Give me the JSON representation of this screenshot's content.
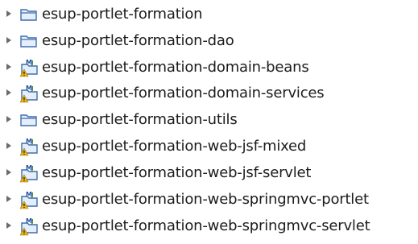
{
  "project_explorer": {
    "items": [
      {
        "label": "esup-portlet-formation",
        "icon": "folder-icon",
        "expanded": false
      },
      {
        "label": "esup-portlet-formation-dao",
        "icon": "folder-icon",
        "expanded": false
      },
      {
        "label": "esup-portlet-formation-domain-beans",
        "icon": "maven-project-warning-icon",
        "expanded": false
      },
      {
        "label": "esup-portlet-formation-domain-services",
        "icon": "maven-project-warning-icon",
        "expanded": false
      },
      {
        "label": "esup-portlet-formation-utils",
        "icon": "folder-icon",
        "expanded": false
      },
      {
        "label": "esup-portlet-formation-web-jsf-mixed",
        "icon": "maven-project-warning-icon",
        "expanded": false
      },
      {
        "label": "esup-portlet-formation-web-jsf-servlet",
        "icon": "maven-project-warning-icon",
        "expanded": false
      },
      {
        "label": "esup-portlet-formation-web-springmvc-portlet",
        "icon": "maven-project-warning-icon",
        "expanded": false
      },
      {
        "label": "esup-portlet-formation-web-springmvc-servlet",
        "icon": "maven-project-warning-icon",
        "expanded": false
      }
    ]
  },
  "colors": {
    "background": "#ffffff",
    "text": "#1c1c1c",
    "arrow": "#6b6b6b",
    "folder": "#3f6fae",
    "maven_letter": "#1e4fa3",
    "warning": "#e8b412"
  }
}
